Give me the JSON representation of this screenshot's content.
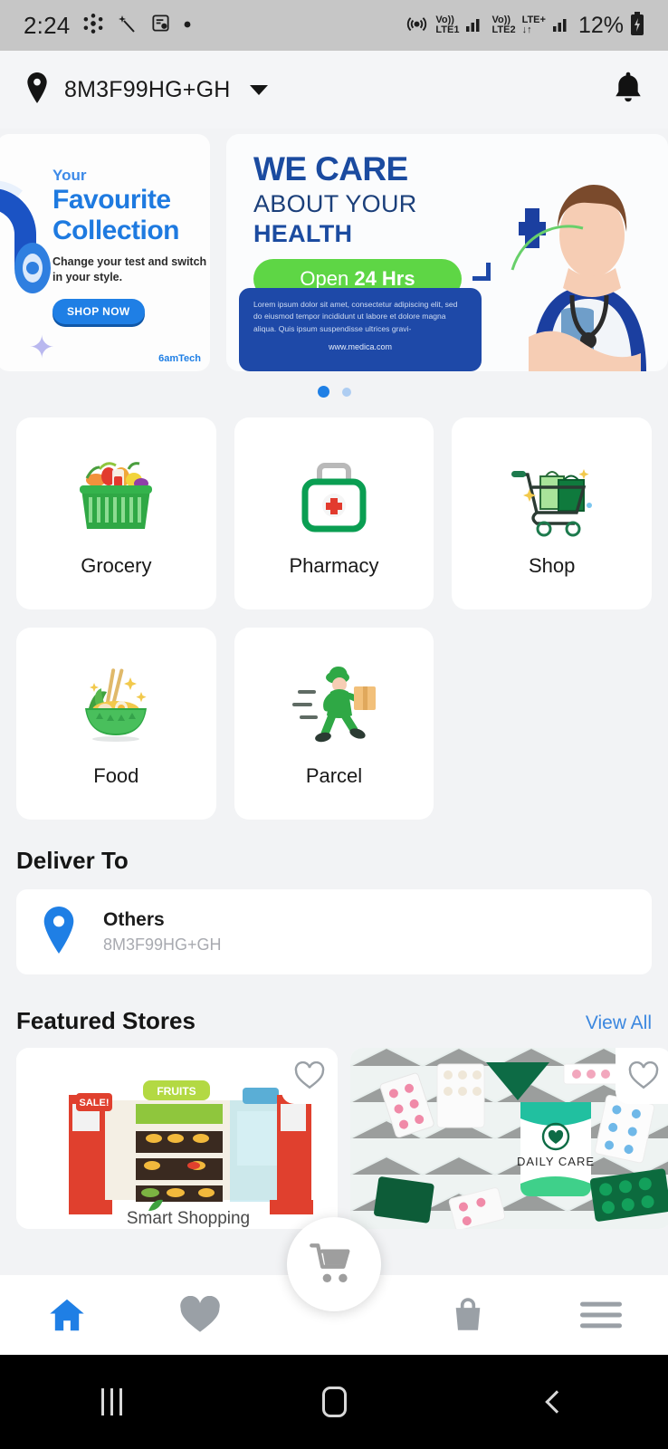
{
  "status_bar": {
    "time": "2:24",
    "left_icons": [
      "share-nodes-icon",
      "magic-wand-icon",
      "note-check-icon",
      "dot-icon"
    ],
    "network1_label_top": "Vo))",
    "network1_label_bottom": "LTE1",
    "network2_label_top": "Vo))",
    "network2_label_bottom": "LTE2",
    "lte_plus_label": "LTE+",
    "battery": "12%",
    "right_icons": [
      "hotspot-icon",
      "signal-icon",
      "signal-icon",
      "battery-charging-icon"
    ]
  },
  "header": {
    "location": "8M3F99HG+GH",
    "location_icon": "map-pin-icon",
    "dropdown_icon": "chevron-down-icon",
    "notification_icon": "bell-icon"
  },
  "carousel": {
    "slide1": {
      "eyebrow": "Your",
      "title_line1": "Favourite",
      "title_line2": "Collection",
      "subtitle": "Change your test and switch in your style.",
      "cta": "SHOP NOW",
      "brand": "6amTech"
    },
    "slide2": {
      "title_line1": "WE CARE",
      "title_line2": "ABOUT YOUR",
      "title_line3": "HEALTH",
      "badge_prefix": "Open ",
      "badge_strong": "24 Hrs",
      "body": "Lorem ipsum dolor sit amet, consectetur adipiscing elit, sed do eiusmod tempor incididunt ut labore et dolore magna aliqua. Quis ipsum suspendisse ultrices gravi-",
      "url": "www.medica.com"
    },
    "dots": {
      "count": 2,
      "active_index": 0
    }
  },
  "categories": [
    {
      "label": "Grocery",
      "icon": "grocery-basket-icon"
    },
    {
      "label": "Pharmacy",
      "icon": "medical-kit-icon"
    },
    {
      "label": "Shop",
      "icon": "shopping-cart-icon"
    },
    {
      "label": "Food",
      "icon": "noodle-bowl-icon"
    },
    {
      "label": "Parcel",
      "icon": "delivery-man-icon"
    }
  ],
  "deliver_to": {
    "section_title": "Deliver To",
    "address_icon": "map-pin-icon",
    "name": "Others",
    "address": "8M3F99HG+GH"
  },
  "featured_stores": {
    "section_title": "Featured Stores",
    "view_all": "View All",
    "stores": [
      {
        "name": "Smart Shopping",
        "banner_label": "FRUITS",
        "sale_label": "SALE!",
        "favorite_icon": "heart-outline-icon"
      },
      {
        "name": "DAILY CARE",
        "favorite_icon": "heart-outline-icon"
      }
    ]
  },
  "bottom_nav": {
    "items": [
      {
        "icon": "home-icon",
        "active": true
      },
      {
        "icon": "heart-icon",
        "active": false
      },
      {
        "icon": "shopping-bag-icon",
        "active": false
      },
      {
        "icon": "menu-icon",
        "active": false
      }
    ],
    "fab_icon": "cart-icon"
  },
  "android_nav": {
    "recents_icon": "recents-icon",
    "home_icon": "home-square-icon",
    "back_icon": "back-chevron-icon"
  },
  "colors": {
    "accent_blue": "#1f7fe5",
    "link_blue": "#3b87df",
    "page_bg": "#f2f3f5",
    "card_bg": "#ffffff",
    "banner_navy": "#1b4ba0",
    "badge_green": "#5ed645"
  }
}
